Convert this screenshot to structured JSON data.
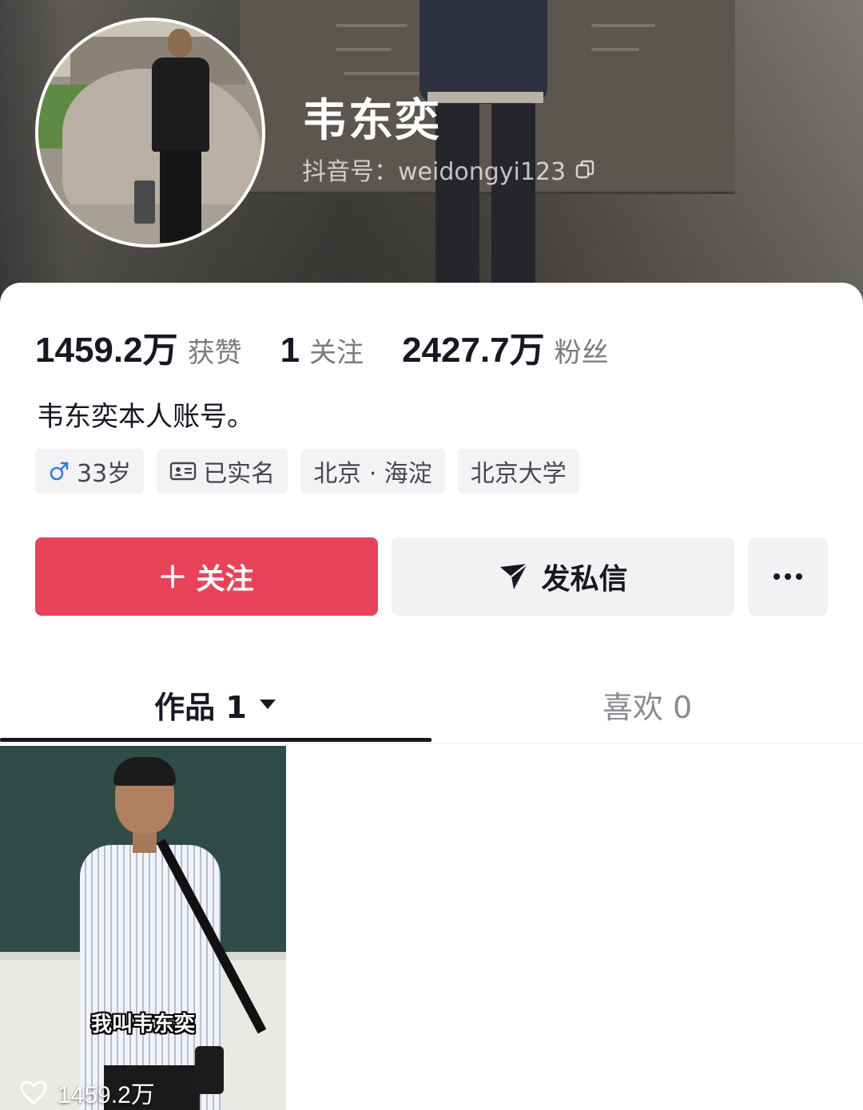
{
  "profile": {
    "nickname": "韦东奕",
    "douyin_id": "抖音号：weidongyi123",
    "copy_icon": "copy-icon"
  },
  "stats": {
    "likes_value": "1459.2万",
    "likes_label": "获赞",
    "following_value": "1",
    "following_label": "关注",
    "followers_value": "2427.7万",
    "followers_label": "粉丝"
  },
  "bio": "韦东奕本人账号。",
  "tags": {
    "age": "33岁",
    "age_icon": "male-icon",
    "verified": "已实名",
    "verified_icon": "id-card-icon",
    "location": "北京 · 海淀",
    "school": "北京大学"
  },
  "actions": {
    "follow_label": "关注",
    "follow_icon": "plus-icon",
    "message_label": "发私信",
    "message_icon": "paper-plane-icon",
    "more_icon": "more-dots-icon"
  },
  "tabs": {
    "works_label": "作品 1",
    "likes_label": "喜欢 0"
  },
  "videos": [
    {
      "caption": "我叫韦东奕",
      "likes": "1459.2万"
    }
  ],
  "colors": {
    "follow_button": "#e94359",
    "secondary_button": "#f2f2f4",
    "primary_text": "#161823",
    "muted_text": "#7a7b80",
    "male_icon": "#3a7bd5"
  }
}
